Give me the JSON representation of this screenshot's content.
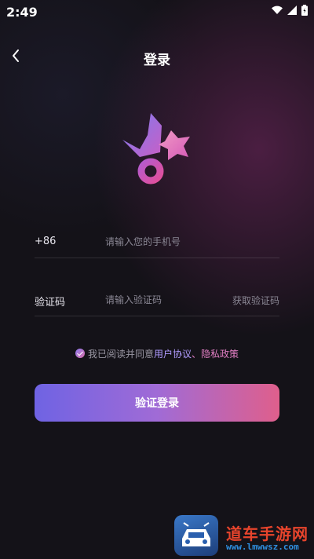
{
  "status_bar": {
    "time": "2:49"
  },
  "nav": {
    "title": "登录"
  },
  "phone_field": {
    "prefix": "+86",
    "placeholder": "请输入您的手机号"
  },
  "code_field": {
    "label": "验证码",
    "placeholder": "请输入验证码",
    "get_code": "获取验证码"
  },
  "agreement": {
    "text": "我已阅读并同意",
    "user_agreement": "用户协议",
    "separator": "、",
    "privacy_policy": "隐私政策",
    "checked": true
  },
  "login_button": {
    "label": "验证登录"
  },
  "watermark": {
    "title": "道车手游网",
    "url": "www.lmwwsz.com"
  },
  "colors": {
    "accent_start": "#6f63e3",
    "accent_end": "#df5f8c",
    "link": "#b19cff"
  }
}
